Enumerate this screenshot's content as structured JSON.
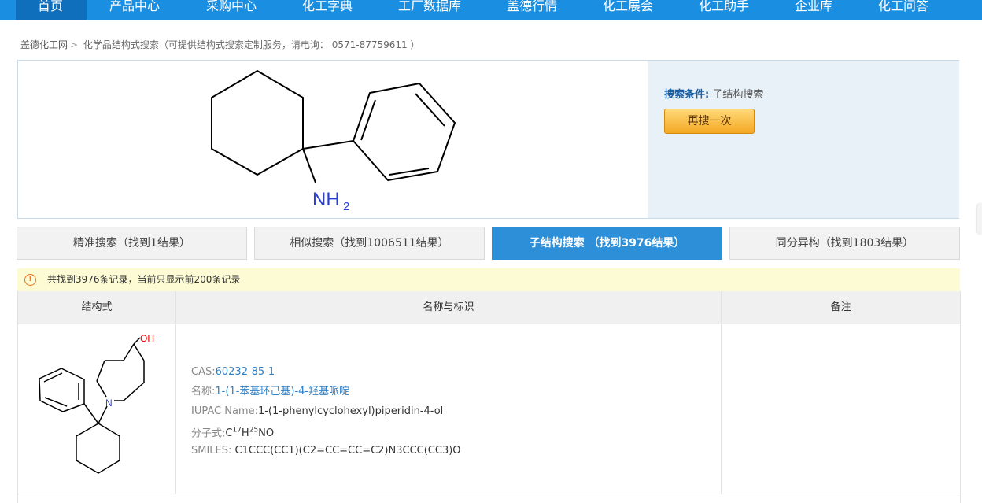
{
  "nav": [
    "首页",
    "产品中心",
    "采购中心",
    "化工字典",
    "工厂数据库",
    "盖德行情",
    "化工展会",
    "化工助手",
    "企业库",
    "化工问答"
  ],
  "breadcrumb": {
    "home": "盖德化工网",
    "sep": ">",
    "current": "化学品结构式搜索（可提供结构式搜索定制服务，请电询： 0571-87759611 ）"
  },
  "query": {
    "amine_label": "NH",
    "amine_sub": "2",
    "condition_label": "搜索条件:",
    "condition_value": "子结构搜索",
    "again_button": "再搜一次"
  },
  "tabs": [
    {
      "label": "精准搜索（找到1结果）",
      "active": false
    },
    {
      "label": "相似搜索（找到1006511结果）",
      "active": false
    },
    {
      "label": "子结构搜索 （找到3976结果）",
      "active": true
    },
    {
      "label": "同分异构（找到1803结果）",
      "active": false
    }
  ],
  "notice": {
    "icon": "warning-icon",
    "text": "共找到3976条记录，当前只显示前200条记录"
  },
  "table": {
    "headers": [
      "结构式",
      "名称与标识",
      "备注"
    ],
    "rows": [
      {
        "oh_label": "OH",
        "n_label": "N",
        "cas_label": "CAS:",
        "cas": "60232-85-1",
        "name_label": "名称:",
        "name": "1-(1-苯基环己基)-4-羟基哌啶",
        "iupac_label": "IUPAC Name:",
        "iupac": "1-(1-phenylcyclohexyl)piperidin-4-ol",
        "formula_label": "分子式:",
        "formula_c": "C",
        "formula_c_n": "17",
        "formula_h": "H",
        "formula_h_n": "25",
        "formula_rest": "NO",
        "smiles_label": "SMILES: ",
        "smiles": "C1CCC(CC1)(C2=CC=CC=C2)N3CCC(CC3)O",
        "remark": ""
      }
    ]
  },
  "colors": {
    "nav": "#1a8ee1",
    "nav_active": "#0f6fbd",
    "tab_active": "#2e8fd9",
    "link": "#2e7fc4",
    "notice_bg": "#fdfbd3",
    "heteroatom_n": "#2a3fd6",
    "heteroatom_o": "#e60000"
  }
}
